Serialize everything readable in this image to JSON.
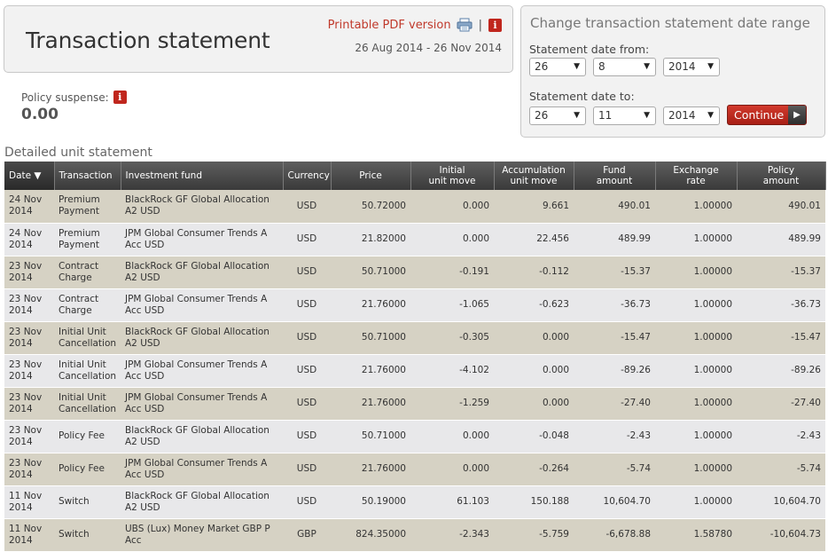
{
  "header": {
    "title": "Transaction statement",
    "pdf_label": "Printable PDF version",
    "separator": "|",
    "info_glyph": "i",
    "date_range": "26 Aug 2014 - 26 Nov 2014"
  },
  "policy_suspense": {
    "label": "Policy suspense:",
    "value": "0.00"
  },
  "date_change": {
    "title": "Change transaction statement date range",
    "from_label": "Statement date from:",
    "to_label": "Statement date to:",
    "from": {
      "day": "26",
      "month": "8",
      "year": "2014"
    },
    "to": {
      "day": "26",
      "month": "11",
      "year": "2014"
    },
    "continue_label": "Continue"
  },
  "statement": {
    "title": "Detailed unit statement",
    "columns": {
      "date": "Date ▼",
      "transaction": "Transaction",
      "fund": "Investment fund",
      "currency": "Currency",
      "price": "Price",
      "initial_1": "Initial",
      "initial_2": "unit move",
      "accum_1": "Accumulation",
      "accum_2": "unit move",
      "fund_amt_1": "Fund",
      "fund_amt_2": "amount",
      "exch_1": "Exchange",
      "exch_2": "rate",
      "policy_1": "Policy",
      "policy_2": "amount"
    },
    "rows": [
      {
        "date": "24 Nov 2014",
        "transaction": "Premium Payment",
        "fund": "BlackRock GF Global Allocation A2 USD",
        "currency": "USD",
        "price": "50.72000",
        "initial": "0.000",
        "accum": "9.661",
        "fund_amount": "490.01",
        "exchange": "1.00000",
        "policy": "490.01"
      },
      {
        "date": "24 Nov 2014",
        "transaction": "Premium Payment",
        "fund": "JPM Global Consumer Trends A Acc USD",
        "currency": "USD",
        "price": "21.82000",
        "initial": "0.000",
        "accum": "22.456",
        "fund_amount": "489.99",
        "exchange": "1.00000",
        "policy": "489.99"
      },
      {
        "date": "23 Nov 2014",
        "transaction": "Contract Charge",
        "fund": "BlackRock GF Global Allocation A2 USD",
        "currency": "USD",
        "price": "50.71000",
        "initial": "-0.191",
        "accum": "-0.112",
        "fund_amount": "-15.37",
        "exchange": "1.00000",
        "policy": "-15.37"
      },
      {
        "date": "23 Nov 2014",
        "transaction": "Contract Charge",
        "fund": "JPM Global Consumer Trends A Acc USD",
        "currency": "USD",
        "price": "21.76000",
        "initial": "-1.065",
        "accum": "-0.623",
        "fund_amount": "-36.73",
        "exchange": "1.00000",
        "policy": "-36.73"
      },
      {
        "date": "23 Nov 2014",
        "transaction": "Initial Unit Cancellation",
        "fund": "BlackRock GF Global Allocation A2 USD",
        "currency": "USD",
        "price": "50.71000",
        "initial": "-0.305",
        "accum": "0.000",
        "fund_amount": "-15.47",
        "exchange": "1.00000",
        "policy": "-15.47"
      },
      {
        "date": "23 Nov 2014",
        "transaction": "Initial Unit Cancellation",
        "fund": "JPM Global Consumer Trends A Acc USD",
        "currency": "USD",
        "price": "21.76000",
        "initial": "-4.102",
        "accum": "0.000",
        "fund_amount": "-89.26",
        "exchange": "1.00000",
        "policy": "-89.26"
      },
      {
        "date": "23 Nov 2014",
        "transaction": "Initial Unit Cancellation",
        "fund": "JPM Global Consumer Trends A Acc USD",
        "currency": "USD",
        "price": "21.76000",
        "initial": "-1.259",
        "accum": "0.000",
        "fund_amount": "-27.40",
        "exchange": "1.00000",
        "policy": "-27.40"
      },
      {
        "date": "23 Nov 2014",
        "transaction": "Policy Fee",
        "fund": "BlackRock GF Global Allocation A2 USD",
        "currency": "USD",
        "price": "50.71000",
        "initial": "0.000",
        "accum": "-0.048",
        "fund_amount": "-2.43",
        "exchange": "1.00000",
        "policy": "-2.43"
      },
      {
        "date": "23 Nov 2014",
        "transaction": "Policy Fee",
        "fund": "JPM Global Consumer Trends A Acc USD",
        "currency": "USD",
        "price": "21.76000",
        "initial": "0.000",
        "accum": "-0.264",
        "fund_amount": "-5.74",
        "exchange": "1.00000",
        "policy": "-5.74"
      },
      {
        "date": "11 Nov 2014",
        "transaction": "Switch",
        "fund": "BlackRock GF Global Allocation A2 USD",
        "currency": "USD",
        "price": "50.19000",
        "initial": "61.103",
        "accum": "150.188",
        "fund_amount": "10,604.70",
        "exchange": "1.00000",
        "policy": "10,604.70"
      },
      {
        "date": "11 Nov 2014",
        "transaction": "Switch",
        "fund": "UBS (Lux) Money Market GBP P Acc",
        "currency": "GBP",
        "price": "824.35000",
        "initial": "-2.343",
        "accum": "-5.759",
        "fund_amount": "-6,678.88",
        "exchange": "1.58780",
        "policy": "-10,604.73"
      }
    ]
  }
}
